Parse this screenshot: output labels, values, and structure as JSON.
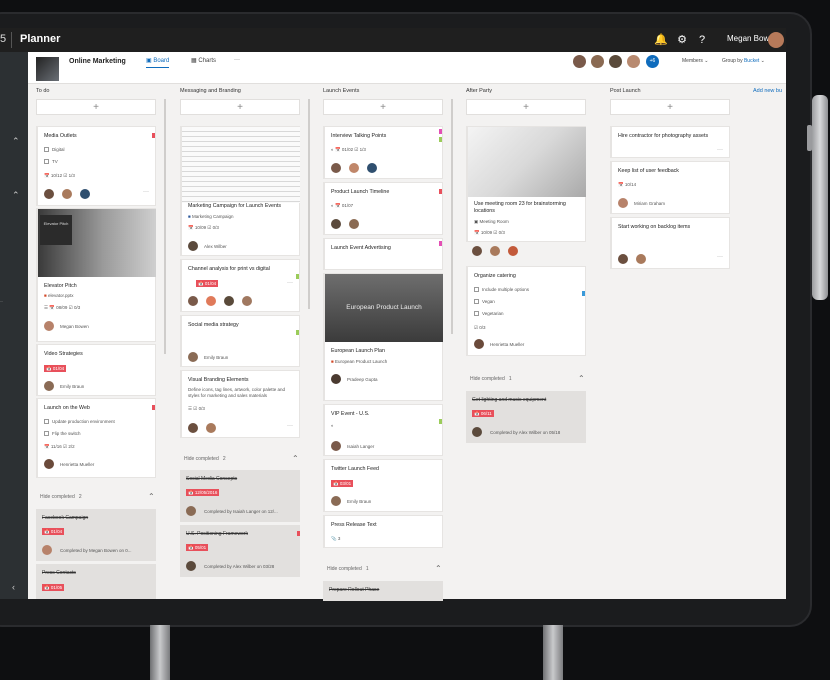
{
  "app": {
    "num": "5",
    "name": "Planner",
    "user": "Megan Bowen"
  },
  "plan": {
    "name": "Online Marketing",
    "tabs": [
      "Board",
      "Charts",
      "···"
    ],
    "more_members": "+6",
    "members_label": "Members",
    "group_by_label": "Group by",
    "group_by_value": "Bucket",
    "add_bucket": "Add new bu"
  },
  "buckets": {
    "todo": {
      "title": "To do",
      "cards": [
        {
          "title": "Media Outlets",
          "items": [
            "Digital",
            "TV"
          ],
          "date": "10/12",
          "checks": "1/3"
        },
        {
          "image_text": "Elevator Pitch",
          "title": "Elevator Pitch",
          "attachment": "elevator.pptx",
          "date": "08/09",
          "checks": "0/3",
          "assignee": "Megan Bowen"
        },
        {
          "title": "Video Strategies",
          "date": "01/04",
          "assignee": "Emily Braun"
        },
        {
          "title": "Launch on the Web",
          "items": [
            "Update production environment",
            "Flip the switch"
          ],
          "date": "11/16",
          "checks": "2/2",
          "assignee": "Henrietta Mueller"
        }
      ],
      "completed": {
        "label": "Hide completed",
        "count": "2",
        "items": [
          {
            "title": "Facebook Campaign",
            "date": "01/04",
            "by": "Completed by Megan Bowen on 0..."
          },
          {
            "title": "Press Contacts",
            "date": "01/05"
          }
        ]
      }
    },
    "messaging": {
      "title": "Messaging and Branding",
      "cards": [
        {
          "title": "Marketing Campaign for Launch Events",
          "attachment": "Marketing Campaign",
          "date": "10/09",
          "checks": "0/3",
          "assignee": "Alex Wilber"
        },
        {
          "title": "Channel analysis for print vs digital",
          "date": "01/04"
        },
        {
          "title": "Social media strategy",
          "assignee": "Emily Braun"
        },
        {
          "title": "Visual Branding Elements",
          "desc": "Define icons, tag lines, artwork, color palette and styles for marketing and sales materials",
          "checks": "0/3"
        }
      ],
      "completed": {
        "label": "Hide completed",
        "count": "2",
        "items": [
          {
            "title": "Social Media Concepts",
            "date": "12/05/2016",
            "by": "Completed by Isaiah Langer on 12/..."
          },
          {
            "title": "U.S. Positioning Framework",
            "date": "05/01",
            "by": "Completed by Alex Wilber on 03/28"
          }
        ]
      }
    },
    "launch": {
      "title": "Launch Events",
      "cards": [
        {
          "title": "Interview Talking Points",
          "date": "01/02",
          "checks": "1/3"
        },
        {
          "title": "Product Launch Timeline",
          "date": "01/07"
        },
        {
          "title": "Launch Event Advertising"
        },
        {
          "image_text": "European Product Launch",
          "title": "European Launch Plan",
          "attachment": "European Product Launch",
          "assignee": "Pradeep Gupta"
        },
        {
          "title": "VIP Event - U.S.",
          "assignee": "Isaiah Langer"
        },
        {
          "title": "Twitter Launch Feed",
          "date": "03/01",
          "assignee": "Emily Braun"
        },
        {
          "title": "Press Release Text",
          "checks": "3"
        }
      ],
      "completed": {
        "label": "Hide completed",
        "count": "1",
        "items": [
          {
            "title": "Prepare Rollout Phase"
          }
        ]
      }
    },
    "after": {
      "title": "After Party",
      "cards": [
        {
          "title": "Use meeting room 23 for brainstorming locations",
          "attachment": "Meeting Room",
          "date": "10/09",
          "checks": "0/3"
        },
        {
          "title": "Organize catering",
          "items": [
            "Include multiple options",
            "Vegan",
            "Vegetarian"
          ],
          "checks": "0/3",
          "assignee": "Henrietta Mueller"
        }
      ],
      "completed": {
        "label": "Hide completed",
        "count": "1",
        "items": [
          {
            "title": "Get lighting and music equipment",
            "date": "06/11",
            "by": "Completed by Alex Wilber on 05/18"
          }
        ]
      }
    },
    "post": {
      "title": "Post Launch",
      "cards": [
        {
          "title": "Hire contractor for photography assets"
        },
        {
          "title": "Keep list of user feedback",
          "date": "10/14",
          "assignee": "Miriam Graham"
        },
        {
          "title": "Start working on backlog items"
        }
      ]
    }
  }
}
